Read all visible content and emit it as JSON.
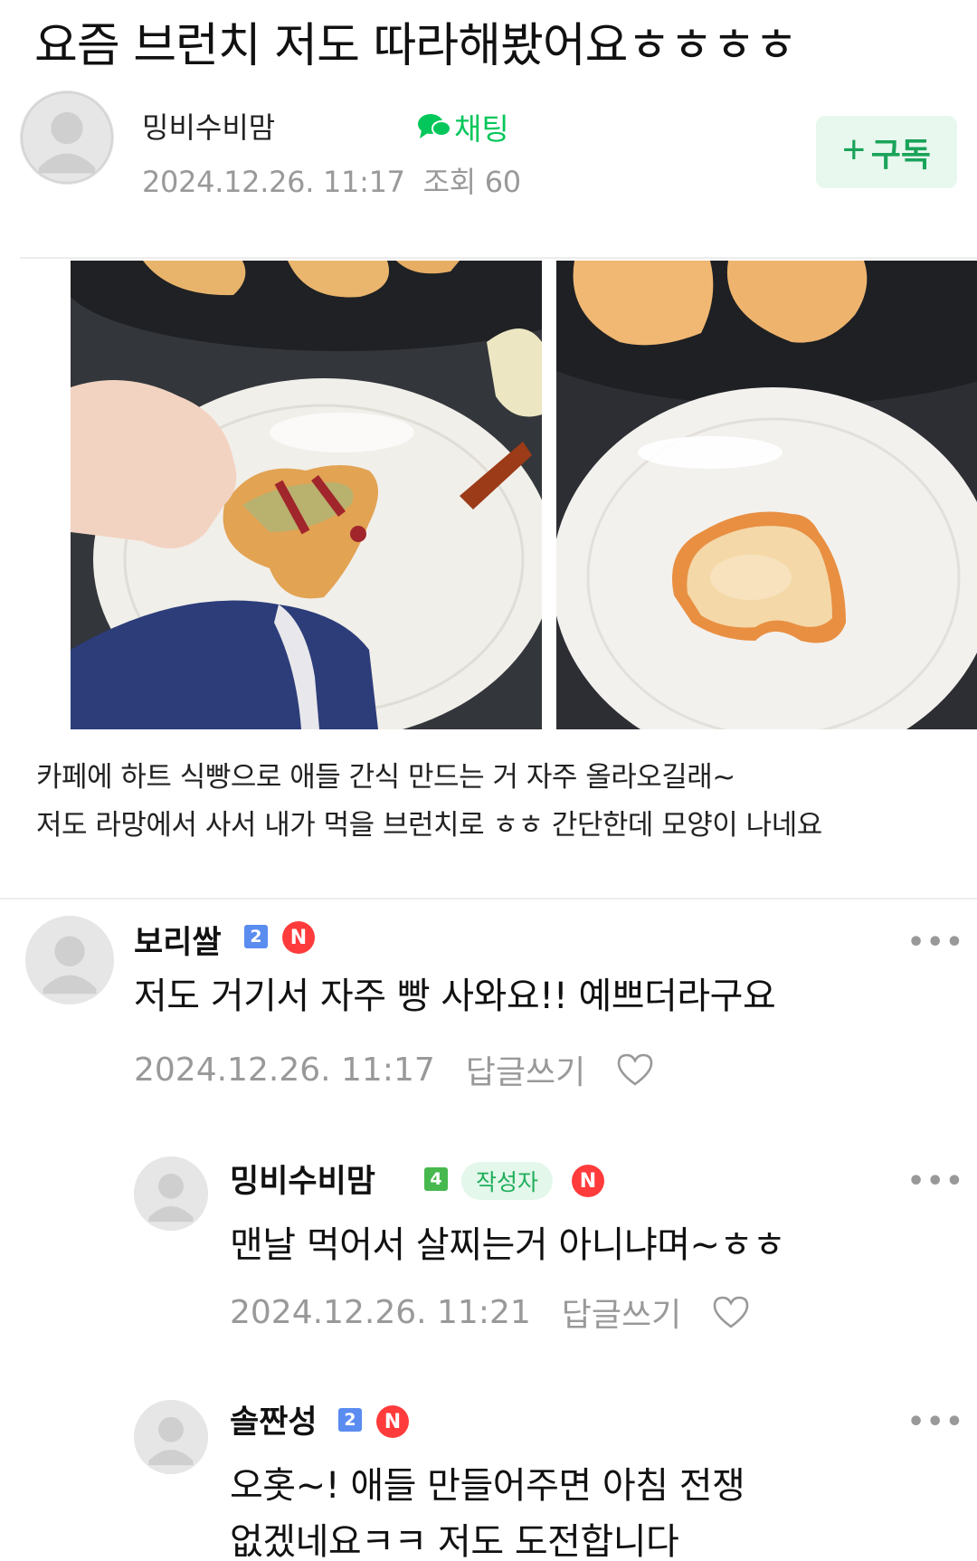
{
  "post": {
    "title": "요즘 브런치 저도 따라해봤어요ㅎㅎㅎㅎ",
    "author": "밍비수비맘",
    "chat_label": "채팅",
    "date": "2024.12.26. 11:17",
    "views_label": "조회 60",
    "subscribe_label": "구독",
    "subscribe_icon": "+",
    "body_lines": [
      "카페에 하트 식빵으로 애들 간식 만드는 거 자주 올라오길래~",
      "저도 라망에서 사서 내가 먹을 브런치로 ㅎㅎ 간단한데 모양이 나네요"
    ]
  },
  "comments": [
    {
      "name": "보리쌀",
      "level": "2",
      "new_badge": "N",
      "text": "저도 거기서 자주 빵 사와요!! 예쁘더라구요",
      "date": "2024.12.26. 11:17",
      "reply_label": "답글쓰기",
      "more": "•••"
    },
    {
      "name": "밍비수비맘",
      "level": "4",
      "author_tag": "작성자",
      "new_badge": "N",
      "text": "맨날 먹어서 살찌는거 아니냐며~ㅎㅎ",
      "date": "2024.12.26. 11:21",
      "reply_label": "답글쓰기",
      "more": "•••"
    },
    {
      "name": "솔짠성",
      "level": "2",
      "new_badge": "N",
      "text_lines": [
        "오홋~! 애들 만들어주면 아침 전쟁",
        "없겠네요ㅋㅋ 저도 도전합니다"
      ],
      "more": "•••"
    }
  ],
  "icons": {
    "chat": "chat-bubble-icon",
    "heart": "heart-outline-icon",
    "avatar": "default-user-avatar-icon"
  },
  "colors": {
    "brand_green": "#03c75a",
    "subscribe_bg": "#e8f8ee",
    "level_blue": "#5b8cf0",
    "level_green": "#46b84e",
    "new_red": "#ff3b3b",
    "meta_gray": "#999999"
  }
}
